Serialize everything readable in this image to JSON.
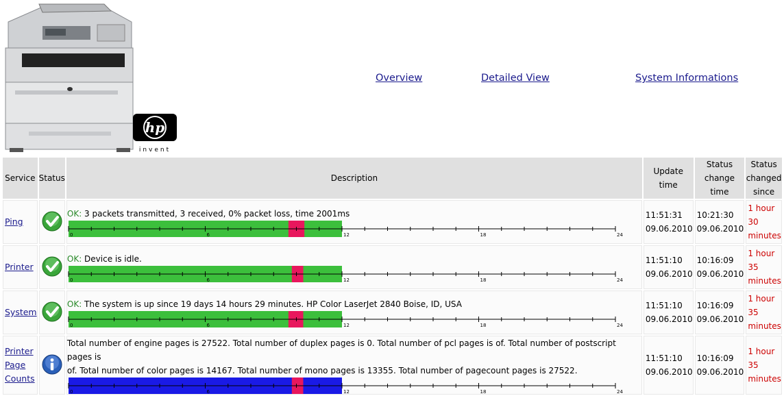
{
  "nav": {
    "overview": "Overview",
    "detailed": "Detailed View",
    "sysinfo": "System Informations"
  },
  "logo": {
    "invent": "invent"
  },
  "table": {
    "headers": {
      "service": "Service",
      "status": "Status",
      "description": "Description",
      "update1": "Update",
      "update2": "time",
      "change1": "Status",
      "change2": "change",
      "change3": "time",
      "since1": "Status",
      "since2": "changed",
      "since3": "since"
    },
    "axis_labels": [
      "0",
      "6",
      "12",
      "18",
      "24"
    ],
    "rows": [
      {
        "service": "Ping",
        "status_icon": "ok-check-icon",
        "ok_prefix": "OK:",
        "desc": " 3 packets transmitted, 3 received, 0% packet loss, time 2001ms",
        "update_time": "11:51:31",
        "update_date": "09.06.2010",
        "change_time": "10:21:30",
        "change_date": "09.06.2010",
        "since1": "1 hour",
        "since2": "30",
        "since3": "minutes",
        "bar": {
          "color": "#3cbf3c",
          "fill_end_hours": 12,
          "marker_start_hours": 9.65,
          "marker_end_hours": 10.35
        }
      },
      {
        "service": "Printer",
        "status_icon": "ok-check-icon",
        "ok_prefix": "OK:",
        "desc": " Device is idle.",
        "update_time": "11:51:10",
        "update_date": "09.06.2010",
        "change_time": "10:16:09",
        "change_date": "09.06.2010",
        "since1": "1 hour",
        "since2": "35",
        "since3": "minutes",
        "bar": {
          "color": "#3cbf3c",
          "fill_end_hours": 12,
          "marker_start_hours": 9.8,
          "marker_end_hours": 10.3
        }
      },
      {
        "service": "System",
        "status_icon": "ok-check-icon",
        "ok_prefix": "OK:",
        "desc": " The system is up since 19 days 14 hours 29 minutes. HP Color LaserJet 2840 Boise, ID, USA",
        "update_time": "11:51:10",
        "update_date": "09.06.2010",
        "change_time": "10:16:09",
        "change_date": "09.06.2010",
        "since1": "1 hour",
        "since2": "35",
        "since3": "minutes",
        "bar": {
          "color": "#3cbf3c",
          "fill_end_hours": 12,
          "marker_start_hours": 9.65,
          "marker_end_hours": 10.3
        }
      },
      {
        "service1": "Printer",
        "service2": "Page",
        "service3": "Counts",
        "status_icon": "info-icon",
        "desc1": "Total number of engine pages is 27522. Total number of duplex pages is 0. Total number of pcl pages is of. Total number of postscript pages is",
        "desc2": "of. Total number of color pages is 14167. Total number of mono pages is 13355. Total number of pagecount pages is 27522.",
        "update_time": "11:51:10",
        "update_date": "09.06.2010",
        "change_time": "10:16:09",
        "change_date": "09.06.2010",
        "since1": "1 hour",
        "since2": "35",
        "since3": "minutes",
        "bar": {
          "color": "#1a1ae6",
          "fill_end_hours": 12,
          "marker_start_hours": 9.8,
          "marker_end_hours": 10.3
        }
      }
    ]
  }
}
